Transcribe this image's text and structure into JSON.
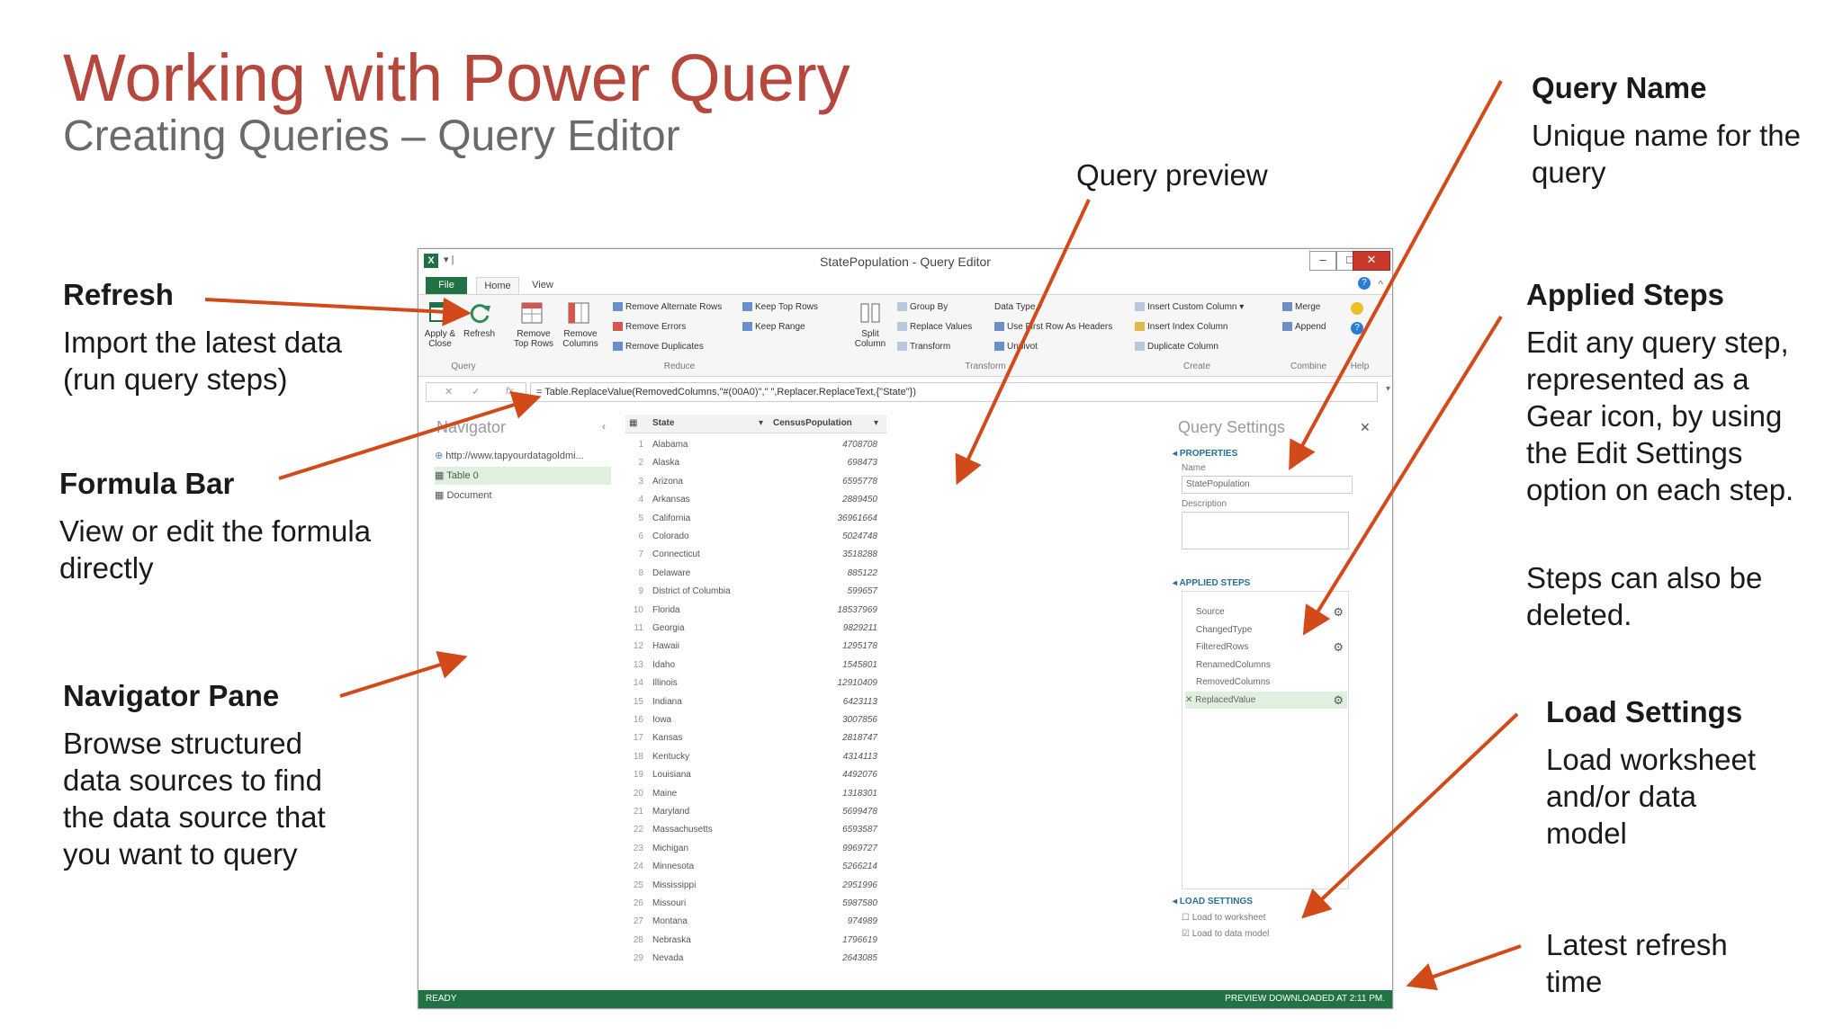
{
  "slide": {
    "title": "Working with Power Query",
    "subtitle": "Creating Queries – Query Editor"
  },
  "callouts": {
    "refresh": {
      "title": "Refresh",
      "body": "Import the latest data (run query steps)"
    },
    "formula_bar": {
      "title": "Formula Bar",
      "body": "View or edit the formula directly"
    },
    "navigator_pane": {
      "title": "Navigator Pane",
      "body": "Browse structured data sources to find the data source that you want to query"
    },
    "query_preview": {
      "title": "Query preview"
    },
    "query_name": {
      "title": "Query Name",
      "body": "Unique name for the query"
    },
    "applied_steps": {
      "title": "Applied Steps",
      "body": "Edit any query step, represented as a Gear icon, by using the Edit Settings option on each step.",
      "body2": "Steps can also be deleted."
    },
    "load_settings": {
      "title": "Load Settings",
      "body": "Load worksheet and/or data model"
    },
    "latest_refresh": {
      "body": "Latest refresh time"
    }
  },
  "window": {
    "title": "StatePopulation - Query Editor",
    "tabs": {
      "file": "File",
      "home": "Home",
      "view": "View"
    },
    "ribbon": {
      "apply_close": "Apply & Close",
      "refresh": "Refresh",
      "remove_top_rows": "Remove Top Rows",
      "remove_columns": "Remove Columns",
      "remove_alternate_rows": "Remove Alternate Rows",
      "remove_errors": "Remove Errors",
      "remove_duplicates": "Remove Duplicates",
      "keep_top_rows": "Keep Top Rows",
      "keep_range": "Keep Range",
      "split_column": "Split Column",
      "group_by": "Group By",
      "replace_values": "Replace Values",
      "transform": "Transform",
      "data_type": "Data Type",
      "use_first_row": "Use First Row As Headers",
      "unpivot": "Unpivot",
      "insert_custom_column": "Insert Custom Column",
      "insert_index_column": "Insert Index Column",
      "duplicate_column": "Duplicate Column",
      "merge": "Merge",
      "append": "Append",
      "groups": {
        "query": "Query",
        "reduce": "Reduce",
        "transform": "Transform",
        "create": "Create",
        "combine": "Combine",
        "help": "Help"
      }
    },
    "formula": "= Table.ReplaceValue(RemovedColumns,\"#(00A0)\",\" \",Replacer.ReplaceText,{\"State\"})",
    "navigator": {
      "title": "Navigator",
      "items": [
        "http://www.tapyourdatagoldmi...",
        "Table 0",
        "Document"
      ]
    },
    "grid": {
      "columns": [
        "State",
        "CensusPopulation"
      ],
      "rows": [
        [
          "1",
          "Alabama",
          "4708708"
        ],
        [
          "2",
          "Alaska",
          "698473"
        ],
        [
          "3",
          "Arizona",
          "6595778"
        ],
        [
          "4",
          "Arkansas",
          "2889450"
        ],
        [
          "5",
          "California",
          "36961664"
        ],
        [
          "6",
          "Colorado",
          "5024748"
        ],
        [
          "7",
          "Connecticut",
          "3518288"
        ],
        [
          "8",
          "Delaware",
          "885122"
        ],
        [
          "9",
          "District of Columbia",
          "599657"
        ],
        [
          "10",
          "Florida",
          "18537969"
        ],
        [
          "11",
          "Georgia",
          "9829211"
        ],
        [
          "12",
          "Hawaii",
          "1295178"
        ],
        [
          "13",
          "Idaho",
          "1545801"
        ],
        [
          "14",
          "Illinois",
          "12910409"
        ],
        [
          "15",
          "Indiana",
          "6423113"
        ],
        [
          "16",
          "Iowa",
          "3007856"
        ],
        [
          "17",
          "Kansas",
          "2818747"
        ],
        [
          "18",
          "Kentucky",
          "4314113"
        ],
        [
          "19",
          "Louisiana",
          "4492076"
        ],
        [
          "20",
          "Maine",
          "1318301"
        ],
        [
          "21",
          "Maryland",
          "5699478"
        ],
        [
          "22",
          "Massachusetts",
          "6593587"
        ],
        [
          "23",
          "Michigan",
          "9969727"
        ],
        [
          "24",
          "Minnesota",
          "5266214"
        ],
        [
          "25",
          "Mississippi",
          "2951996"
        ],
        [
          "26",
          "Missouri",
          "5987580"
        ],
        [
          "27",
          "Montana",
          "974989"
        ],
        [
          "28",
          "Nebraska",
          "1796619"
        ],
        [
          "29",
          "Nevada",
          "2643085"
        ]
      ]
    },
    "query_settings": {
      "title": "Query Settings",
      "properties": "PROPERTIES",
      "name_label": "Name",
      "name_value": "StatePopulation",
      "description_label": "Description",
      "applied_steps": "APPLIED STEPS",
      "steps": [
        "Source",
        "ChangedType",
        "FilteredRows",
        "RenamedColumns",
        "RemovedColumns",
        "ReplacedValue"
      ],
      "load_settings": "LOAD SETTINGS",
      "load_to_worksheet": "Load to worksheet",
      "load_to_data_model": "Load to data model"
    },
    "status": {
      "left": "READY",
      "right": "PREVIEW DOWNLOADED AT 2:11 PM."
    }
  },
  "colors": {
    "title": "#b5473c",
    "arrow": "#d24a1a",
    "excel_green": "#217346"
  }
}
